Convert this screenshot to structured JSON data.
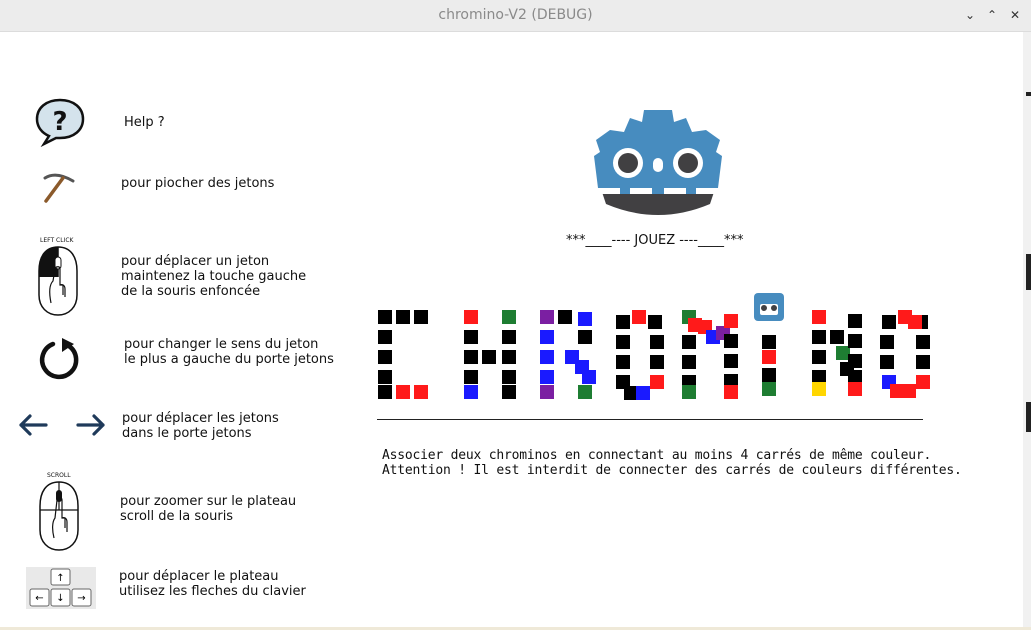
{
  "window": {
    "title": "chromino-V2 (DEBUG)",
    "controls": [
      "⌄",
      "⌃",
      "✕"
    ]
  },
  "help": {
    "items": [
      {
        "icon": "help-bubble-icon",
        "text": "Help ?"
      },
      {
        "icon": "pickaxe-icon",
        "text": "pour piocher des jetons"
      },
      {
        "icon": "mouse-left-click-icon",
        "label": "LEFT CLICK",
        "text": "pour déplacer un jeton\nmaintenez la touche gauche\nde la souris enfoncée"
      },
      {
        "icon": "rotate-icon",
        "text": "pour changer le sens du jeton\nle plus a gauche du porte jetons"
      },
      {
        "icon": "arrows-left-right-icon",
        "text": "pour déplacer les jetons\ndans le porte jetons"
      },
      {
        "icon": "mouse-scroll-icon",
        "label": "SCROLL",
        "text": "pour zoomer sur le plateau\nscroll de la souris"
      },
      {
        "icon": "arrow-keys-icon",
        "text": "pour déplacer le plateau\nutilisez les fleches du clavier"
      }
    ]
  },
  "main": {
    "logo_icon": "godot-logo-icon",
    "tagline": "***____---- JOUEZ ----____***",
    "title_icon": "godot-small-icon",
    "rules": [
      "Associer deux chrominos en connectant au moins 4 carrés de même couleur.",
      "Attention ! Il est interdit de connecter des carrés de couleurs différentes."
    ]
  },
  "colors": {
    "black": "#000000",
    "red": "#ff1a1a",
    "green": "#1e7d32",
    "blue": "#1a1aff",
    "purple": "#7b1fa2",
    "yellow": "#ffd600",
    "godot_blue": "#478cbf",
    "godot_dark": "#414042"
  }
}
